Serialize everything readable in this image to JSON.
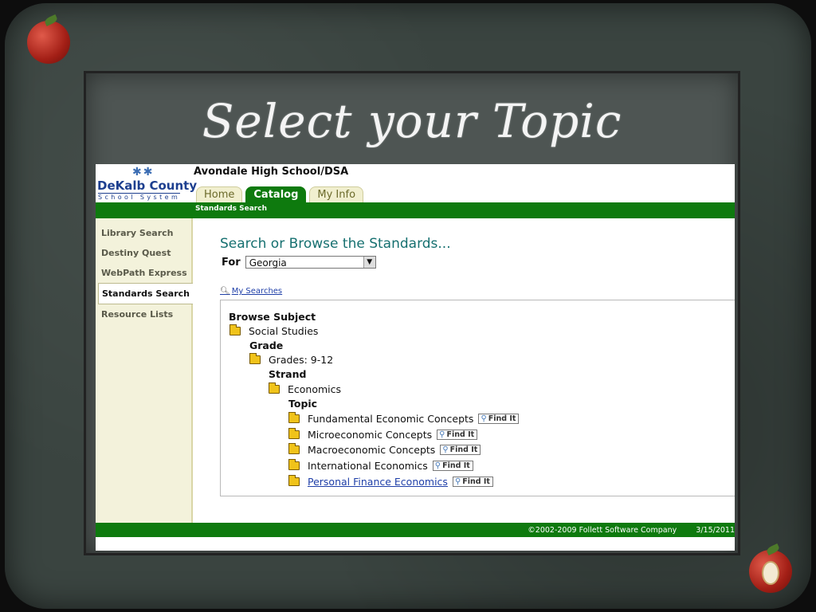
{
  "slide": {
    "title": "Select your Topic"
  },
  "header": {
    "logo_name": "DeKalb County",
    "logo_sub": "School System",
    "school": "Avondale High School/DSA",
    "tabs": [
      {
        "label": "Home",
        "active": false
      },
      {
        "label": "Catalog",
        "active": true
      },
      {
        "label": "My Info",
        "active": false
      }
    ],
    "breadcrumb": "Standards Search"
  },
  "sidebar": {
    "items": [
      {
        "label": "Library Search"
      },
      {
        "label": "Destiny Quest"
      },
      {
        "label": "WebPath Express"
      },
      {
        "label": "Standards Search",
        "active": true
      },
      {
        "label": "Resource Lists"
      }
    ]
  },
  "main": {
    "heading": "Search or Browse the Standards...",
    "for_label": "For",
    "for_value": "Georgia",
    "my_searches": "My Searches",
    "browse_subject_label": "Browse Subject",
    "subject": "Social Studies",
    "grade_label": "Grade",
    "grade": "Grades: 9-12",
    "strand_label": "Strand",
    "strand": "Economics",
    "topic_label": "Topic",
    "topics": [
      {
        "name": "Fundamental Economic Concepts"
      },
      {
        "name": "Microeconomic Concepts"
      },
      {
        "name": "Macroeconomic Concepts"
      },
      {
        "name": "International Economics"
      },
      {
        "name": "Personal Finance Economics"
      }
    ],
    "find_it": "Find It"
  },
  "footer": {
    "copyright": "©2002-2009  Follett Software Company",
    "date": "3/15/2011"
  }
}
